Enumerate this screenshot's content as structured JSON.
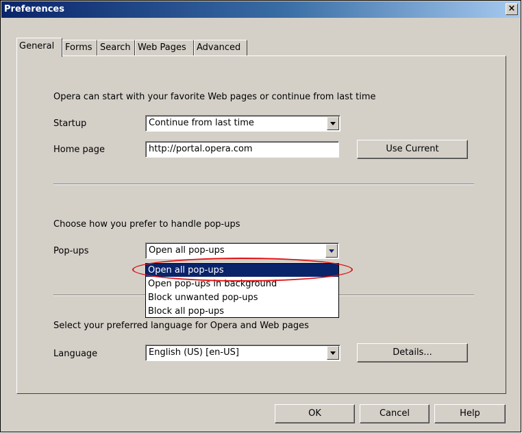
{
  "window": {
    "title": "Preferences",
    "close_glyph": "×"
  },
  "tabs": [
    {
      "label": "General",
      "active": true
    },
    {
      "label": "Forms",
      "active": false
    },
    {
      "label": "Search",
      "active": false
    },
    {
      "label": "Web Pages",
      "active": false
    },
    {
      "label": "Advanced",
      "active": false
    }
  ],
  "startup_section": {
    "description": "Opera can start with your favorite Web pages or continue from last time",
    "startup_label": "Startup",
    "startup_value": "Continue from last time",
    "homepage_label": "Home page",
    "homepage_value": "http://portal.opera.com",
    "use_current_label": "Use Current"
  },
  "popup_section": {
    "description": "Choose how you prefer to handle pop-ups",
    "popups_label": "Pop-ups",
    "popups_value": "Open all pop-ups",
    "options": [
      "Open all pop-ups",
      "Open pop-ups in background",
      "Block unwanted pop-ups",
      "Block all pop-ups"
    ],
    "selected_index": 0
  },
  "language_section": {
    "description": "Select your preferred language for Opera and Web pages",
    "language_label": "Language",
    "language_value": "English (US) [en-US]",
    "details_label": "Details..."
  },
  "footer": {
    "ok_label": "OK",
    "cancel_label": "Cancel",
    "help_label": "Help"
  },
  "colors": {
    "highlight_ring": "#e01010",
    "selection": "#0a246a",
    "dialog_face": "#d4d0c8"
  },
  "icons": {
    "close": "close-icon",
    "dropdown_arrow": "chevron-down-icon"
  }
}
